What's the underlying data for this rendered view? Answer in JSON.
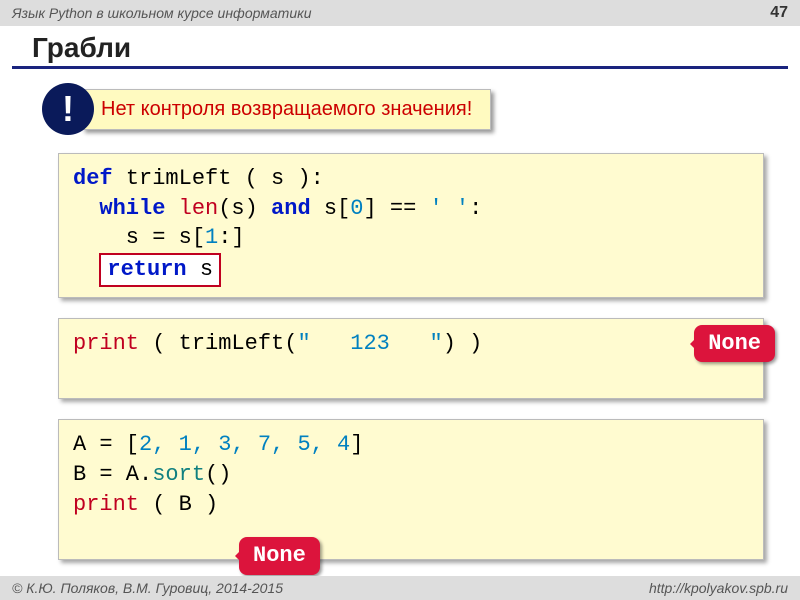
{
  "header": {
    "course": "Язык Python в школьном курсе информатики",
    "page": "47"
  },
  "title": "Грабли",
  "warning": {
    "mark": "!",
    "text": "Нет контроля возвращаемого значения!"
  },
  "code1": {
    "def": "def",
    "fname": "trimLeft",
    "params": " ( s ):",
    "while": "while",
    "len": "len",
    "lenarg": "(s)",
    "and": "and",
    "idx_open": " s[",
    "zero": "0",
    "idx_close": "]",
    "eq": " == ",
    "space_lit": "' '",
    "colon": ":",
    "assign_lhs": "    s = s[",
    "one": "1",
    "slice_end": ":]",
    "return": "return",
    "retvar": " s"
  },
  "code2": {
    "print": "print",
    "open": " ( ",
    "call": "trimLeft(",
    "arg": "\"   123   \"",
    "close": ") )"
  },
  "callout1": "None",
  "code3": {
    "line1_pre": "A = [",
    "nums": "2, 1, 3, 7, 5, 4",
    "line1_post": "]",
    "line2_pre": "B = A",
    "dot": ".",
    "sort": "sort",
    "line2_post": "()",
    "print": "print",
    "pargs": " ( B )"
  },
  "callout2": "None",
  "footer": {
    "left": "© К.Ю. Поляков, В.М. Гуровиц, 2014-2015",
    "right": "http://kpolyakov.spb.ru"
  }
}
